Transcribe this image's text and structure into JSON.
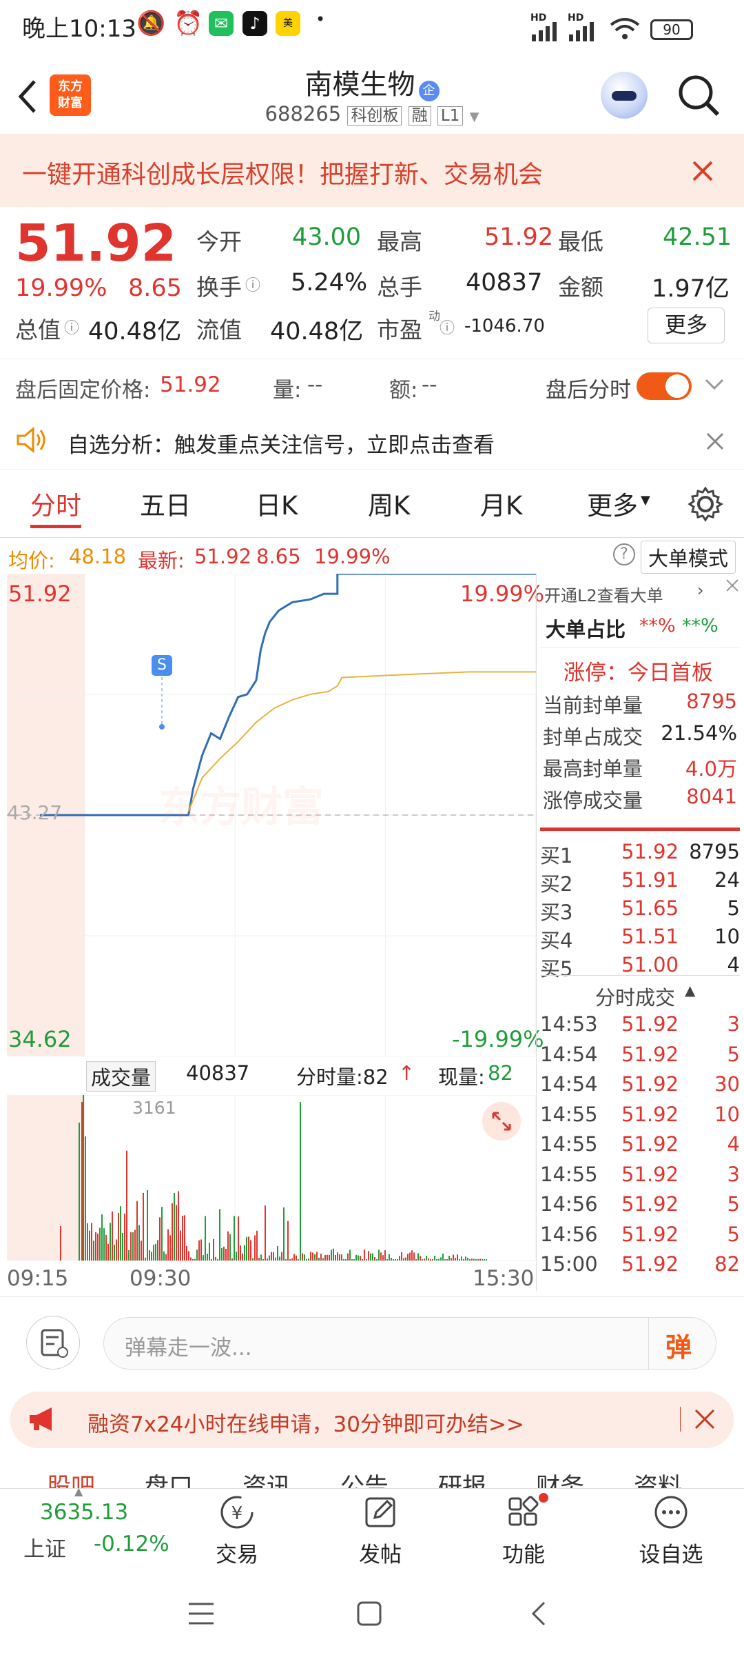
{
  "status": {
    "time": "晚上10:13",
    "battery": "90",
    "signal_a": "HD",
    "signal_b": "HD"
  },
  "header": {
    "logo_line1": "东方",
    "logo_line2": "财富",
    "stock_name": "南模生物",
    "badge": "企",
    "code": "688265",
    "tag_board": "科创板",
    "tag_margin": "融",
    "tag_level": "L1"
  },
  "banner": {
    "text": "一键开通科创成长层权限！把握打新、交易机会"
  },
  "quote": {
    "price": "51.92",
    "change_pct": "19.99%",
    "change": "8.65",
    "open_label": "今开",
    "open": "43.00",
    "high_label": "最高",
    "high": "51.92",
    "low_label": "最低",
    "low": "42.51",
    "turnover_label": "换手",
    "turnover": "5.24%",
    "volume_label": "总手",
    "volume": "40837",
    "amount_label": "金额",
    "amount": "1.97亿",
    "mcap_label": "总值",
    "mcap": "40.48亿",
    "float_label": "流值",
    "float": "40.48亿",
    "pe_label": "市盈",
    "pe_sup": "动",
    "pe": "-1046.70",
    "more_label": "更多"
  },
  "afterhours": {
    "price_label": "盘后固定价格:",
    "price": "51.92",
    "vol_label": "量:",
    "vol": "--",
    "amt_label": "额:",
    "amt": "--",
    "toggle_label": "盘后分时"
  },
  "signal": {
    "text": "自选分析：触发重点关注信号，立即点击查看"
  },
  "tabs": [
    "分时",
    "五日",
    "日K",
    "周K",
    "月K",
    "更多"
  ],
  "avgbar": {
    "avg_label": "均价:",
    "avg": "48.18",
    "latest_label": "最新:",
    "latest": "51.92",
    "chg": "8.65",
    "pct": "19.99%",
    "bigorder_mode": "大单模式"
  },
  "chart_data": {
    "type": "line",
    "y_labels": {
      "top": "51.92",
      "mid": "43.27",
      "bottom": "34.62",
      "top_pct": "19.99%",
      "bottom_pct": "-19.99%"
    },
    "ylim": [
      34.62,
      51.92
    ],
    "prev_close": 43.27,
    "watermark": "东方财富",
    "marker": "S",
    "time_labels": [
      "09:15",
      "09:30",
      "15:30"
    ],
    "series": [
      {
        "x": [
          0,
          0.23,
          0.24,
          0.26,
          0.28,
          0.3,
          0.32,
          0.34,
          0.36,
          0.38,
          0.39,
          0.4,
          0.41,
          0.43,
          0.46,
          0.5,
          0.53,
          0.56,
          0.56,
          1
        ],
        "values": [
          43.27,
          43.27,
          44.2,
          45.4,
          46.2,
          46.0,
          46.8,
          47.5,
          47.6,
          48.1,
          49.2,
          49.8,
          50.2,
          50.6,
          50.9,
          51.0,
          51.2,
          51.2,
          51.92,
          51.92
        ]
      },
      {
        "x": [
          0.23,
          0.26,
          0.3,
          0.34,
          0.38,
          0.42,
          0.46,
          0.5,
          0.54,
          0.56,
          0.57,
          0.7,
          0.85,
          1
        ],
        "values": [
          43.4,
          44.6,
          45.3,
          45.9,
          46.6,
          47.1,
          47.4,
          47.6,
          47.7,
          47.9,
          48.2,
          48.3,
          48.4,
          48.4
        ]
      }
    ]
  },
  "volume": {
    "label": "成交量",
    "total": "40837",
    "tick_label": "分时量:82",
    "current_label": "现量:",
    "current": "82",
    "peak": "3161"
  },
  "orderpanel": {
    "l2_link": "开通L2查看大单",
    "bigorder_label": "大单占比",
    "bigorder_a": "**%",
    "bigorder_b": "**%",
    "limit_label": "涨停：今日首板",
    "stats": [
      {
        "label": "当前封单量",
        "value": "8795"
      },
      {
        "label": "封单占成交",
        "value": "21.54%"
      },
      {
        "label": "最高封单量",
        "value": "4.0万"
      },
      {
        "label": "涨停成交量",
        "value": "8041"
      }
    ],
    "bids": [
      {
        "label": "买1",
        "price": "51.92",
        "qty": "8795"
      },
      {
        "label": "买2",
        "price": "51.91",
        "qty": "24"
      },
      {
        "label": "买3",
        "price": "51.65",
        "qty": "5"
      },
      {
        "label": "买4",
        "price": "51.51",
        "qty": "10"
      },
      {
        "label": "买5",
        "price": "51.00",
        "qty": "4"
      }
    ],
    "trades_label": "分时成交",
    "trades": [
      {
        "time": "14:53",
        "price": "51.92",
        "qty": "3"
      },
      {
        "time": "14:54",
        "price": "51.92",
        "qty": "5"
      },
      {
        "time": "14:54",
        "price": "51.92",
        "qty": "30"
      },
      {
        "time": "14:55",
        "price": "51.92",
        "qty": "10"
      },
      {
        "time": "14:55",
        "price": "51.92",
        "qty": "4"
      },
      {
        "time": "14:55",
        "price": "51.92",
        "qty": "3"
      },
      {
        "time": "14:56",
        "price": "51.92",
        "qty": "5"
      },
      {
        "time": "14:56",
        "price": "51.92",
        "qty": "5"
      },
      {
        "time": "15:00",
        "price": "51.92",
        "qty": "82"
      }
    ]
  },
  "danmu": {
    "placeholder": "弹幕走一波...",
    "send": "弹"
  },
  "promo": {
    "text": "融资7x24小时在线申请，30分钟即可办结>>"
  },
  "subtabs": [
    "股吧",
    "盘口",
    "资讯",
    "公告",
    "研报",
    "财务",
    "资料"
  ],
  "bottomnav": {
    "index_value": "3635.13",
    "index_name": "上证",
    "index_pct": "-0.12%",
    "items": [
      "交易",
      "发帖",
      "功能",
      "设自选"
    ]
  }
}
